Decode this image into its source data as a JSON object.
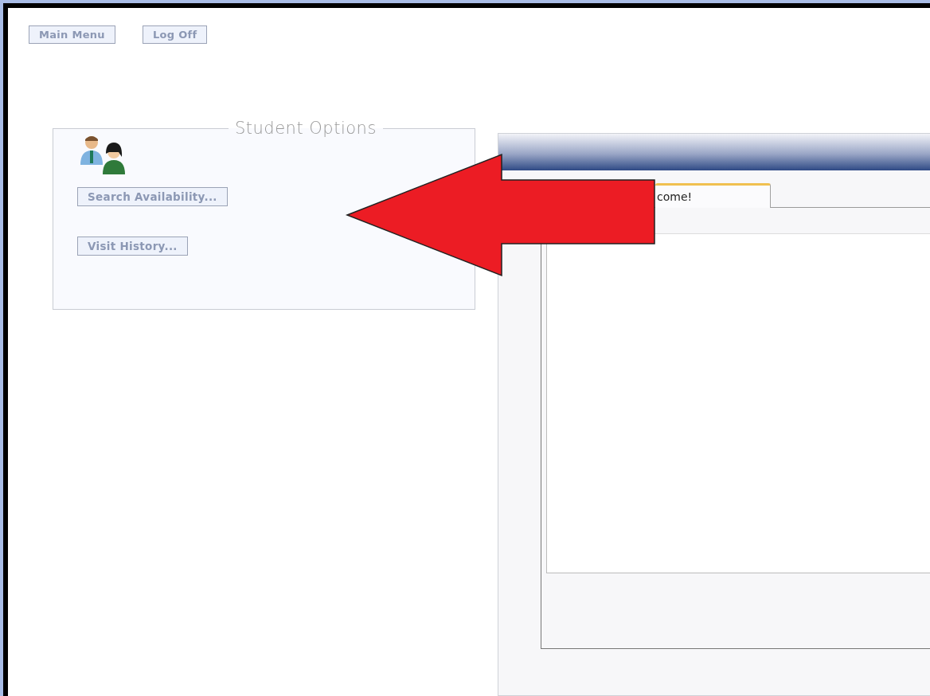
{
  "top_buttons": [
    "Main Menu",
    "Log Off"
  ],
  "student_options": {
    "title": "Student Options",
    "buttons": [
      "Search Availability...",
      "Visit History..."
    ]
  },
  "panel": {
    "tabs": [
      {
        "label": "come!",
        "selected": true
      }
    ]
  }
}
